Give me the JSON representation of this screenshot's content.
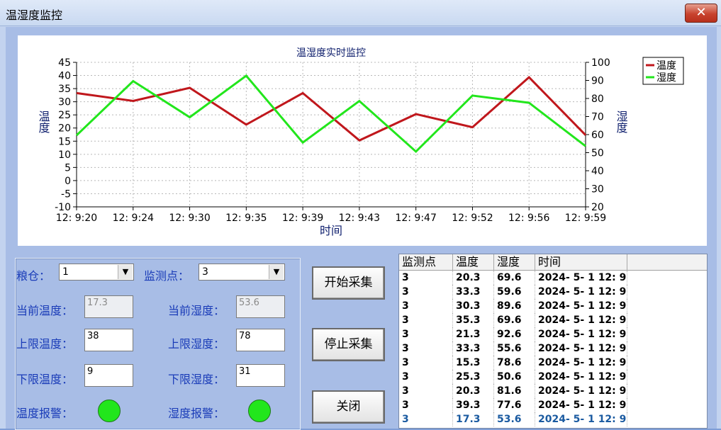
{
  "window": {
    "title": "温湿度监控",
    "close_glyph": "✕"
  },
  "chart_data": {
    "type": "line",
    "title": "温湿度实时监控",
    "xlabel": "时间",
    "ylabel_left": "温度",
    "ylabel_right": "湿度",
    "categories": [
      "12: 9:20",
      "12: 9:24",
      "12: 9:30",
      "12: 9:35",
      "12: 9:39",
      "12: 9:43",
      "12: 9:47",
      "12: 9:52",
      "12: 9:56",
      "12: 9:59"
    ],
    "y_left": {
      "min": -10,
      "max": 45,
      "ticks": [
        "45",
        "40",
        "35",
        "30",
        "25",
        "20",
        "15",
        "10",
        "5",
        "0",
        "-5",
        "-10"
      ]
    },
    "y_right": {
      "min": 20,
      "max": 100,
      "ticks": [
        "100",
        "90",
        "80",
        "70",
        "60",
        "50",
        "40",
        "30",
        "20"
      ]
    },
    "grid": true,
    "legend_placement": "top-right",
    "series": [
      {
        "name": "温度",
        "axis": "left",
        "color": "#c0171c",
        "values": [
          33.3,
          30.3,
          35.3,
          21.3,
          33.3,
          15.3,
          25.3,
          20.3,
          39.3,
          17.3
        ]
      },
      {
        "name": "湿度",
        "axis": "right",
        "color": "#22e61c",
        "values": [
          59.6,
          89.6,
          69.6,
          92.6,
          55.6,
          78.6,
          50.6,
          81.6,
          77.6,
          53.6
        ]
      }
    ]
  },
  "controls": {
    "granary_label": "粮仓：",
    "granary_value": "1",
    "point_label": "监测点：",
    "point_value": "3",
    "cur_temp_label": "当前温度：",
    "cur_temp_value": "17.3",
    "cur_hum_label": "当前湿度：",
    "cur_hum_value": "53.6",
    "upper_temp_label": "上限温度：",
    "upper_temp_value": "38",
    "upper_hum_label": "上限湿度：",
    "upper_hum_value": "78",
    "lower_temp_label": "下限温度：",
    "lower_temp_value": "9",
    "lower_hum_label": "下限湿度：",
    "lower_hum_value": "31",
    "temp_alarm_label": "温度报警：",
    "hum_alarm_label": "湿度报警：",
    "alarm_color": "#22e61c"
  },
  "buttons": {
    "start": "开始采集",
    "stop": "停止采集",
    "close": "关闭"
  },
  "table": {
    "headers": [
      "监测点",
      "温度",
      "湿度",
      "时间"
    ],
    "rows": [
      [
        "3",
        "20.3",
        "69.6",
        "2024- 5- 1 12: 9:..."
      ],
      [
        "3",
        "33.3",
        "59.6",
        "2024- 5- 1 12: 9:..."
      ],
      [
        "3",
        "30.3",
        "89.6",
        "2024- 5- 1 12: 9:..."
      ],
      [
        "3",
        "35.3",
        "69.6",
        "2024- 5- 1 12: 9:..."
      ],
      [
        "3",
        "21.3",
        "92.6",
        "2024- 5- 1 12: 9:..."
      ],
      [
        "3",
        "33.3",
        "55.6",
        "2024- 5- 1 12: 9:..."
      ],
      [
        "3",
        "15.3",
        "78.6",
        "2024- 5- 1 12: 9:..."
      ],
      [
        "3",
        "25.3",
        "50.6",
        "2024- 5- 1 12: 9:..."
      ],
      [
        "3",
        "20.3",
        "81.6",
        "2024- 5- 1 12: 9:..."
      ],
      [
        "3",
        "39.3",
        "77.6",
        "2024- 5- 1 12: 9:..."
      ],
      [
        "3",
        "17.3",
        "53.6",
        "2024- 5- 1 12: 9:..."
      ]
    ]
  }
}
